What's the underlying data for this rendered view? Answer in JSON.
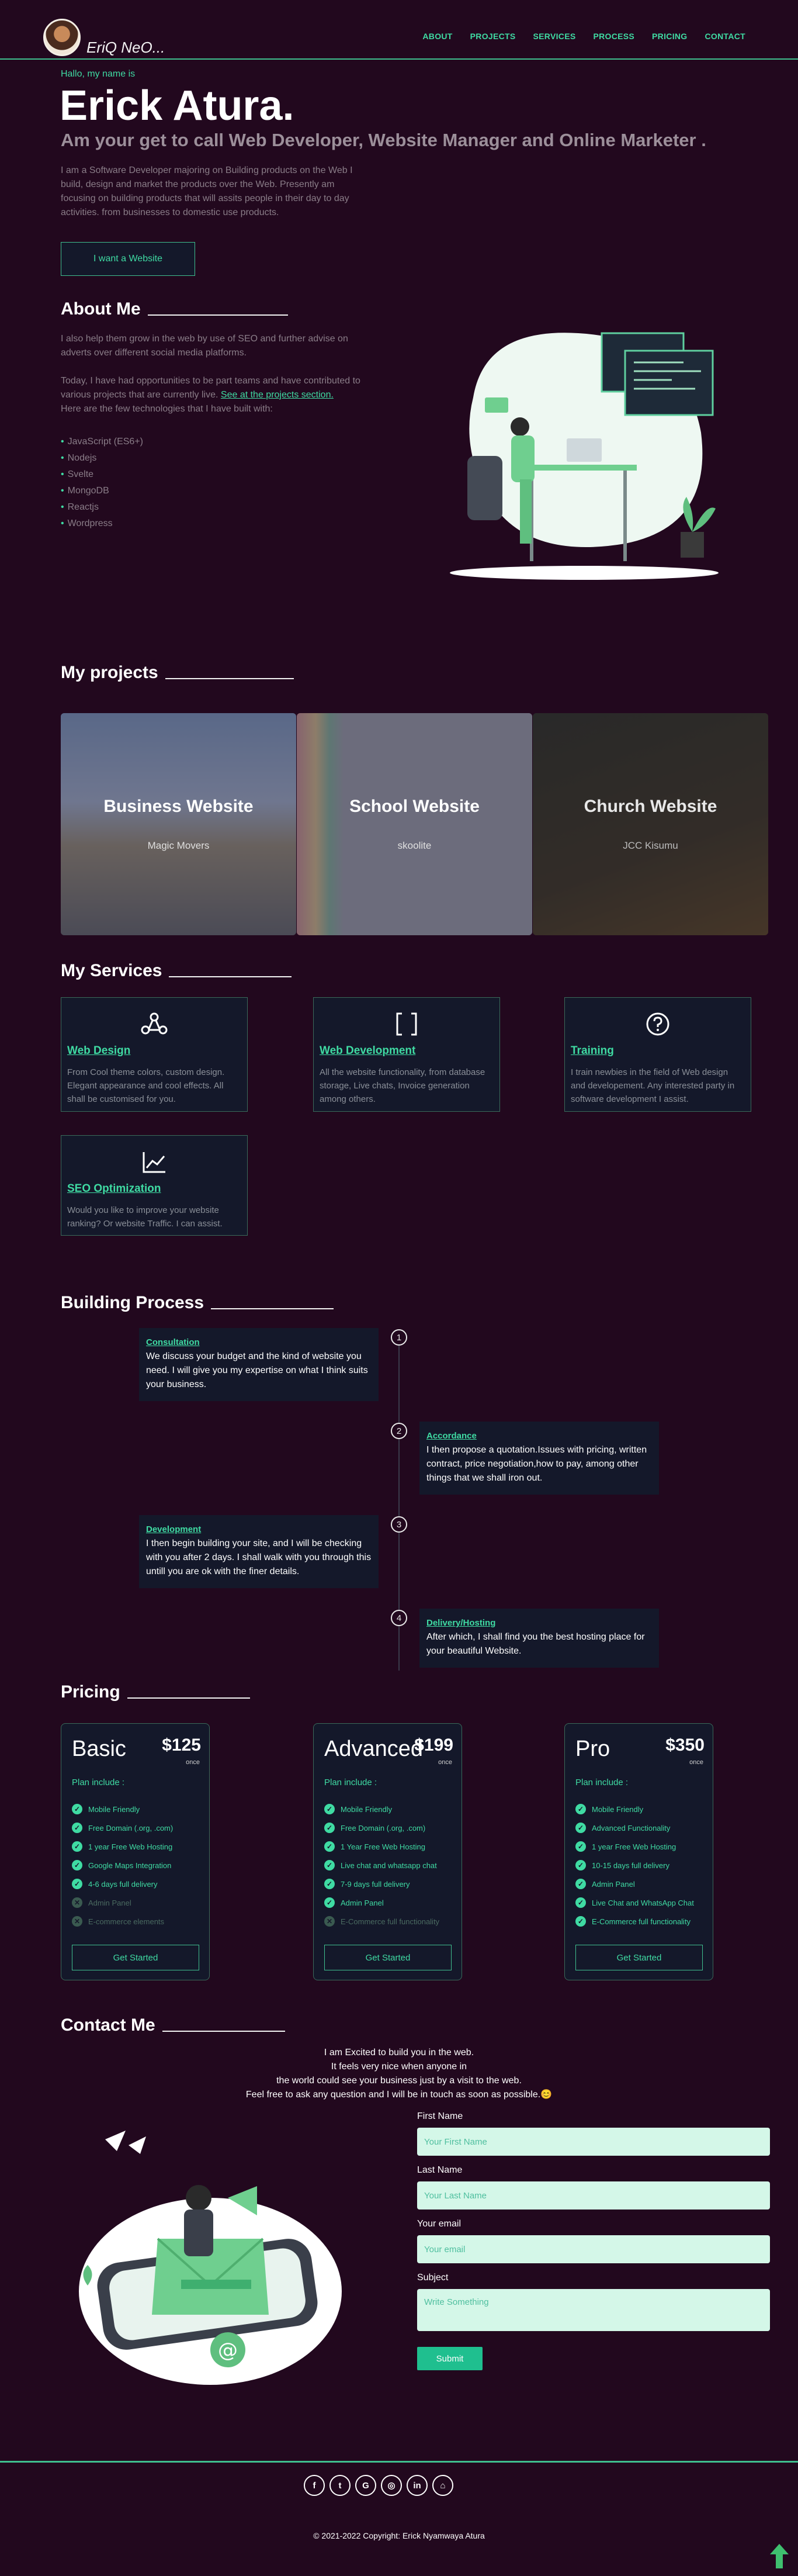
{
  "nav": {
    "logo": "EriQ NeO...",
    "links": [
      "ABOUT",
      "PROJECTS",
      "SERVICES",
      "PROCESS",
      "PRICING",
      "CONTACT"
    ]
  },
  "hero": {
    "greeting": "Hallo, my name is",
    "name": "Erick Atura.",
    "subtitle": "Am your get to call Web Developer, Website Manager and Online Marketer .",
    "description": "I am a Software Developer majoring on Building products on the Web I build, design and market the products over the Web. Presently am focusing on building products that will assits people in their day to day activities. from businesses to domestic use products.",
    "cta": "I want a Website"
  },
  "about": {
    "title": "About Me",
    "p1": "I also help them grow in the web by use of SEO and further advise on adverts over different social media platforms.",
    "p2_before": "Today, I have had opportunities to be part teams and have contributed to various projects that are currently live.",
    "p2_link": "See at the projects section.",
    "p3": "Here are the few technologies that I have built with:",
    "tech": [
      "JavaScript (ES6+)",
      "Nodejs",
      "Svelte",
      "MongoDB",
      "Reactjs",
      "Wordpress"
    ]
  },
  "projects": {
    "title": "My projects",
    "items": [
      {
        "title": "Business Website",
        "subtitle": "Magic Movers"
      },
      {
        "title": "School Website",
        "subtitle": "skoolite"
      },
      {
        "title": "Church Website",
        "subtitle": "JCC Kisumu"
      }
    ]
  },
  "services": {
    "title": "My Services",
    "items": [
      {
        "title": "Web Design",
        "desc": "From Cool theme colors, custom design. Elegant appearance and cool effects. All shall be customised for you.",
        "icon": "palette-icon"
      },
      {
        "title": "Web Development",
        "desc": "All the website functionality, from database storage, Live chats, Invoice generation among others.",
        "icon": "brackets-icon"
      },
      {
        "title": "Training",
        "desc": "I train newbies in the field of Web design and developement. Any interested party in software development I assist.",
        "icon": "question-icon"
      },
      {
        "title": "SEO Optimization",
        "desc": "Would you like to improve your website ranking? Or website Traffic. I can assist.",
        "icon": "chart-line-icon"
      }
    ]
  },
  "process": {
    "title": "Building Process",
    "steps": [
      {
        "num": "1",
        "title": "Consultation",
        "desc": "We discuss your budget and the kind of website you need. I will give you my expertise on what I think suits your business."
      },
      {
        "num": "2",
        "title": "Accordance",
        "desc": "I then propose a quotation.Issues with pricing, written contract, price negotiation,how to pay, among other things that we shall iron out."
      },
      {
        "num": "3",
        "title": "Development",
        "desc": "I then begin building your site, and I will be checking with you after 2 days. I shall walk with you through this untill you are ok with the finer details."
      },
      {
        "num": "4",
        "title": "Delivery/Hosting",
        "desc": "After which, I shall find you the best hosting place for your beautiful Website."
      }
    ]
  },
  "pricing": {
    "title": "Pricing",
    "plan_label": "Plan include :",
    "cta": "Get Started",
    "once": "once",
    "plans": [
      {
        "name": "Basic",
        "price": "$125",
        "features": [
          {
            "t": "Mobile Friendly",
            "on": true
          },
          {
            "t": "Free Domain (.org, .com)",
            "on": true
          },
          {
            "t": "1 year Free Web Hosting",
            "on": true
          },
          {
            "t": "Google Maps Integration",
            "on": true
          },
          {
            "t": "4-6 days full delivery",
            "on": true
          },
          {
            "t": "Admin Panel",
            "on": false
          },
          {
            "t": "E-commerce elements",
            "on": false
          }
        ]
      },
      {
        "name": "Advanced",
        "price": "$199",
        "features": [
          {
            "t": "Mobile Friendly",
            "on": true
          },
          {
            "t": "Free Domain (.org, .com)",
            "on": true
          },
          {
            "t": "1 Year Free Web Hosting",
            "on": true
          },
          {
            "t": "Live chat and whatsapp chat",
            "on": true
          },
          {
            "t": "7-9 days full delivery",
            "on": true
          },
          {
            "t": "Admin Panel",
            "on": true
          },
          {
            "t": "E-Commerce full functionality",
            "on": false
          }
        ]
      },
      {
        "name": "Pro",
        "price": "$350",
        "features": [
          {
            "t": "Mobile Friendly",
            "on": true
          },
          {
            "t": "Advanced Functionality",
            "on": true
          },
          {
            "t": "1 year Free Web Hosting",
            "on": true
          },
          {
            "t": "10-15 days full delivery",
            "on": true
          },
          {
            "t": "Admin Panel",
            "on": true
          },
          {
            "t": "Live Chat and WhatsApp Chat",
            "on": true
          },
          {
            "t": "E-Commerce full functionality",
            "on": true
          }
        ]
      }
    ]
  },
  "contact": {
    "title": "Contact Me",
    "intro": [
      "I am Excited to build you in the web.",
      "It feels very nice when anyone in",
      "the world could see your business just by a visit to the web.",
      "Feel free to ask any question and I will be in touch as soon as possible.😊"
    ],
    "fields": [
      {
        "label": "First Name",
        "placeholder": "Your First Name"
      },
      {
        "label": "Last Name",
        "placeholder": "Your Last Name"
      },
      {
        "label": "Your email",
        "placeholder": "Your email"
      },
      {
        "label": "Subject",
        "placeholder": "Write Something"
      }
    ],
    "submit": "Submit"
  },
  "footer": {
    "socials": [
      "facebook-icon",
      "twitter-icon",
      "google-icon",
      "instagram-icon",
      "linkedin-icon",
      "github-icon"
    ],
    "copyright": "© 2021-2022 Copyright: Erick Nyamwaya Atura"
  },
  "colors": {
    "bg": "#22081e",
    "accent": "#3fdba3",
    "card": "#14182a"
  }
}
